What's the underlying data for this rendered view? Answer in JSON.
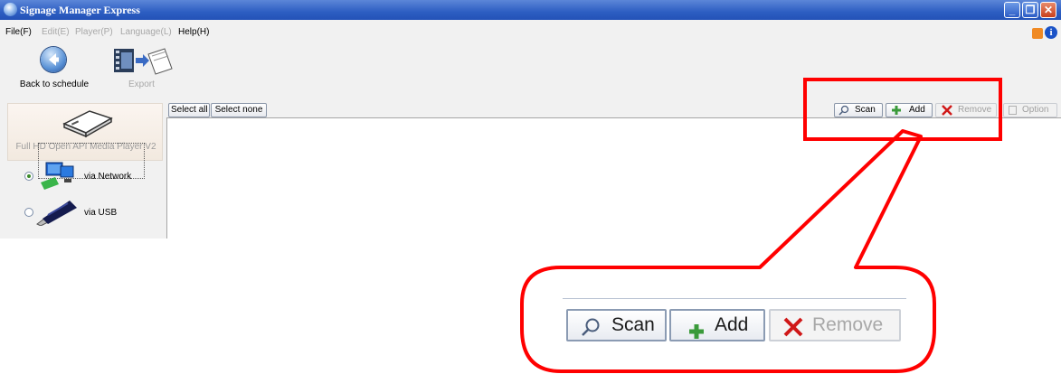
{
  "window": {
    "title": "Signage Manager Express",
    "controls": [
      "minimize",
      "maximize",
      "close"
    ]
  },
  "menu": [
    {
      "label": "File(F)",
      "enabled": true
    },
    {
      "label": "Edit(E)",
      "enabled": false
    },
    {
      "label": "Player(P)",
      "enabled": false
    },
    {
      "label": "Language(L)",
      "enabled": false
    },
    {
      "label": "Help(H)",
      "enabled": true
    }
  ],
  "toolbar": {
    "back_label": "Back to schedule",
    "export_label": "Export"
  },
  "sidebar": {
    "player_label": "Full HD Open API Media Player V2",
    "options": [
      {
        "label": "via Network",
        "selected": true
      },
      {
        "label": "via USB",
        "selected": false
      }
    ]
  },
  "main": {
    "select_all": "Select all",
    "select_none": "Select none",
    "scan": "Scan",
    "add": "Add",
    "remove": "Remove",
    "option": "Option"
  },
  "callout": {
    "scan": "Scan",
    "add": "Add",
    "remove": "Remove"
  },
  "colors": {
    "highlight": "#ff0000",
    "titlebar": "#2d5ec2"
  }
}
